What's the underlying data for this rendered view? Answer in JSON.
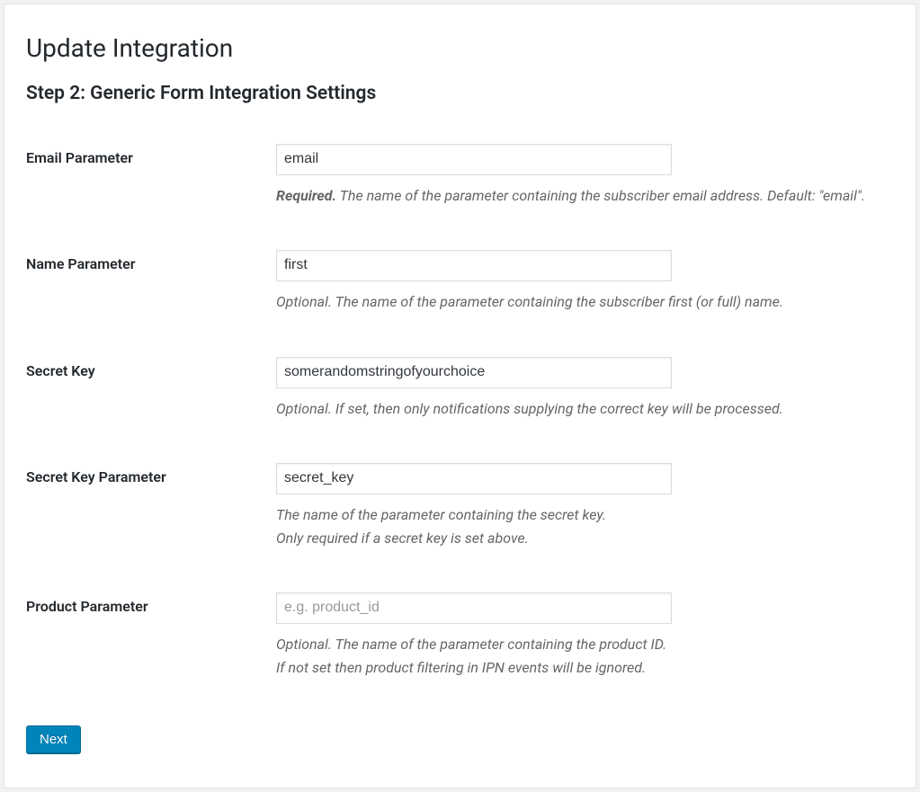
{
  "page": {
    "title": "Update Integration",
    "subtitle": "Step 2: Generic Form Integration Settings"
  },
  "fields": {
    "email_parameter": {
      "label": "Email Parameter",
      "value": "email",
      "required_word": "Required.",
      "desc": " The name of the parameter containing the subscriber email address. Default: \"email\"."
    },
    "name_parameter": {
      "label": "Name Parameter",
      "value": "first",
      "desc": "Optional. The name of the parameter containing the subscriber first (or full) name."
    },
    "secret_key": {
      "label": "Secret Key",
      "value": "somerandomstringofyourchoice",
      "desc": "Optional. If set, then only notifications supplying the correct key will be processed."
    },
    "secret_key_parameter": {
      "label": "Secret Key Parameter",
      "value": "secret_key",
      "desc_line1": "The name of the parameter containing the secret key.",
      "desc_line2": "Only required if a secret key is set above."
    },
    "product_parameter": {
      "label": "Product Parameter",
      "value": "",
      "placeholder": "e.g. product_id",
      "desc_line1": "Optional. The name of the parameter containing the product ID.",
      "desc_line2": "If not set then product filtering in IPN events will be ignored."
    }
  },
  "buttons": {
    "next": "Next"
  }
}
